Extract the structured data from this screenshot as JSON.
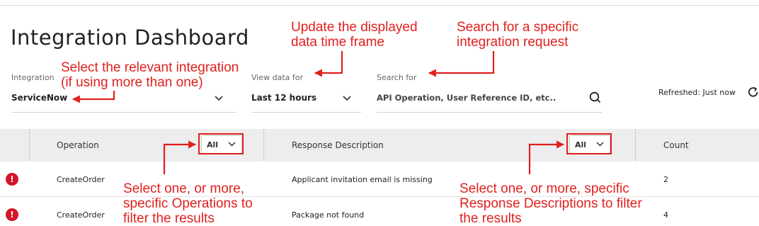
{
  "header": {
    "title": "Integration Dashboard"
  },
  "filters": {
    "integration": {
      "label": "Integration",
      "value": "ServiceNow"
    },
    "view_data": {
      "label": "View data for",
      "value": "Last 12 hours"
    },
    "search": {
      "label": "Search for",
      "placeholder": "API Operation, User Reference ID, etc.."
    }
  },
  "status": {
    "refreshed": "Refreshed: Just now"
  },
  "table": {
    "columns": {
      "operation": "Operation",
      "operation_filter": "All",
      "response_description": "Response Description",
      "response_filter": "All",
      "count": "Count"
    },
    "rows": [
      {
        "operation": "CreateOrder",
        "response_description": "Applicant invitation email is missing",
        "count": "2"
      },
      {
        "operation": "CreateOrder",
        "response_description": "Package not found",
        "count": "4"
      }
    ]
  },
  "annotations": {
    "integration": [
      "Select the relevant integration",
      "(if using more than one)"
    ],
    "time_frame": [
      "Update the displayed",
      "data time frame"
    ],
    "search": [
      "Search for a specific",
      "integration request"
    ],
    "operations": [
      "Select one, or more,",
      "specific Operations to",
      "filter the results"
    ],
    "responses": [
      "Select one, or more, specific",
      "Response Descriptions to filter",
      "the results"
    ]
  },
  "colors": {
    "annotation": "#e0201e",
    "error_icon": "#d3152a",
    "header_bg": "#ededed"
  },
  "icons": {
    "search": "search-icon",
    "refresh": "refresh-icon",
    "error": "error-icon",
    "dropdown": "chevron-down-icon"
  }
}
